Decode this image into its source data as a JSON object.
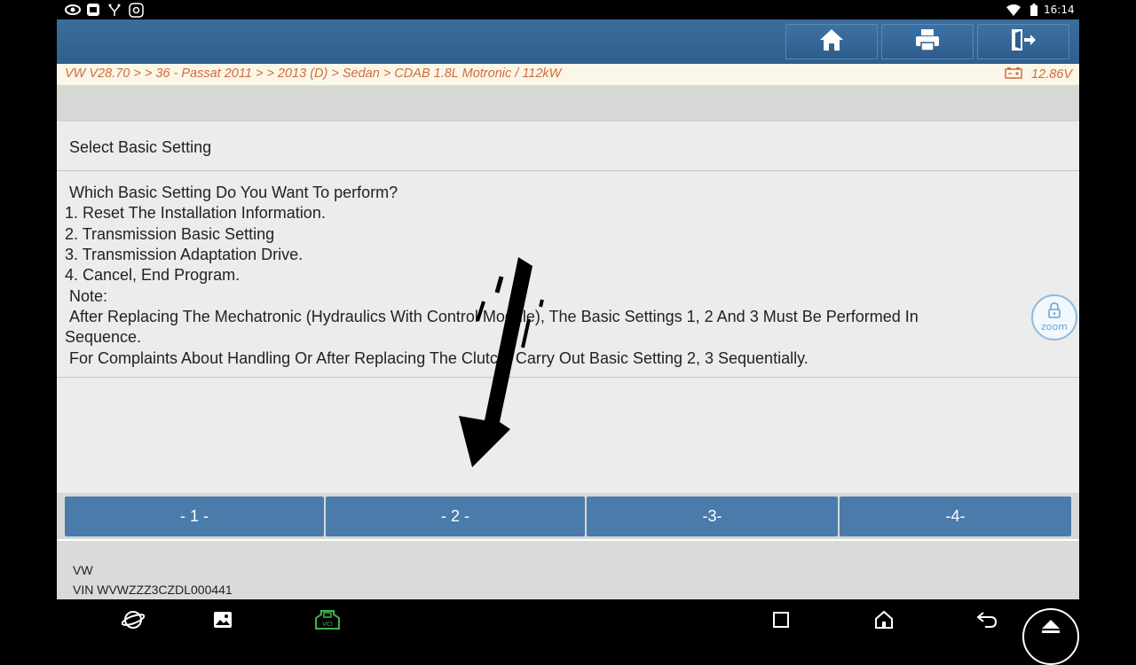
{
  "status": {
    "time": "16:14"
  },
  "breadcrumb": "VW V28.70 >  > 36 - Passat 2011 > > 2013 (D) > Sedan > CDAB 1.8L Motronic / 112kW",
  "voltage": "12.86V",
  "panel_title": "Select Basic Setting",
  "message_lines": [
    "Which Basic Setting Do You Want To perform?",
    "1. Reset The Installation Information.",
    "2. Transmission Basic Setting",
    "3. Transmission Adaptation Drive.",
    "4. Cancel, End Program.",
    "Note:",
    "After Replacing The Mechatronic (Hydraulics With Control Module), The Basic Settings 1, 2 And 3 Must Be Performed In",
    "Sequence.",
    "For Complaints About Handling Or After Replacing The Clutch, Carry Out Basic Setting 2, 3 Sequentially."
  ],
  "zoom_label": "zoom",
  "options": [
    "- 1 -",
    "- 2 -",
    "-3-",
    "-4-"
  ],
  "footer": {
    "make": "VW",
    "vin": "VIN WVWZZZ3CZDL000441"
  },
  "icons": {
    "topbar": [
      "home-icon",
      "print-icon",
      "exit-icon"
    ],
    "status_left": [
      "eye-icon",
      "screen-icon",
      "usb-icon",
      "settings-icon"
    ],
    "status_right": [
      "wifi-icon",
      "battery-icon"
    ],
    "nav": [
      "browser-icon",
      "gallery-icon",
      "vci-icon",
      "recent-apps-icon",
      "home-nav-icon",
      "back-icon",
      "up-icon"
    ]
  },
  "colors": {
    "topbar": "#2f5f8c",
    "breadcrumb_text": "#d46a3b",
    "option_button": "#4a7bab",
    "vci_green": "#3cb54a"
  }
}
